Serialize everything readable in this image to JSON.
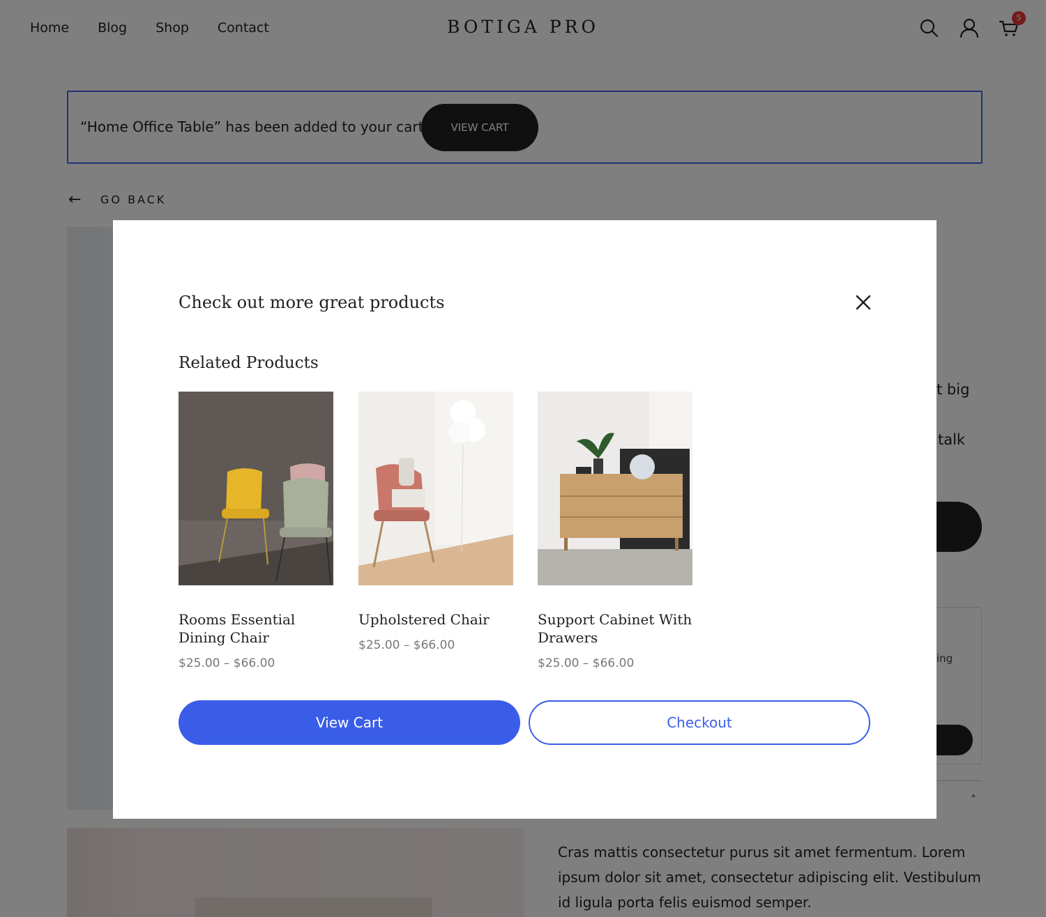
{
  "header": {
    "nav": [
      "Home",
      "Blog",
      "Shop",
      "Contact"
    ],
    "logo": "BOTIGA PRO",
    "icons": [
      "search-icon",
      "user-icon",
      "cart-icon"
    ],
    "cart_count": "5"
  },
  "notice": {
    "text": "“Home Office Table” has been added to your cart.",
    "button": "VIEW CART"
  },
  "go_back": {
    "arrow": "←",
    "label": "GO BACK"
  },
  "background": {
    "snippet_1": "t big",
    "snippet_2": "talk",
    "snippet_3": "ing",
    "chevron": "˄",
    "description": "Cras mattis consectetur purus sit amet fermentum. Lorem ipsum dolor sit amet, consectetur adipiscing elit. Vestibulum id ligula porta felis euismod semper."
  },
  "modal": {
    "title": "Check out more great products",
    "related_heading": "Related Products",
    "products": [
      {
        "name": "Rooms Essential Dining Chair",
        "price": "$25.00 – $66.00"
      },
      {
        "name": "Upholstered Chair",
        "price": "$25.00 – $66.00"
      },
      {
        "name": "Support Cabinet With Drawers",
        "price": "$25.00 – $66.00"
      }
    ],
    "view_cart": "View Cart",
    "checkout": "Checkout"
  },
  "colors": {
    "accent": "#3a5de8",
    "dark": "#212121",
    "badge": "#e53935"
  }
}
